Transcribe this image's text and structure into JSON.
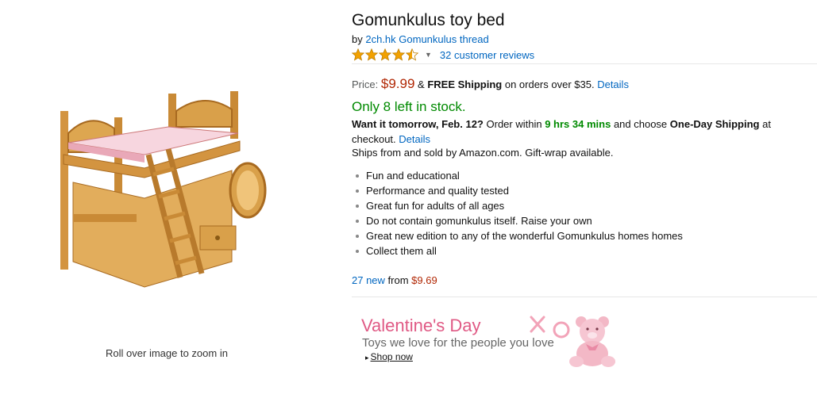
{
  "product": {
    "title": "Gomunkulus toy bed",
    "by_prefix": "by",
    "brand_link": "2ch.hk Gomunkulus thread",
    "rating_stars": 4.5,
    "reviews_link": "32 customer reviews",
    "zoom_hint": "Roll over image to zoom in"
  },
  "price": {
    "label": "Price:",
    "value": "$9.99",
    "free_shipping_prefix": "&",
    "free_shipping_bold": "FREE Shipping",
    "free_shipping_suffix": "on orders over $35.",
    "details_link": "Details"
  },
  "availability": {
    "stock": "Only 8 left in stock.",
    "want_it": "Want it tomorrow, Feb. 12?",
    "order_within": "Order within",
    "time_left": "9 hrs 34 mins",
    "and_choose": "and choose",
    "one_day": "One-Day Shipping",
    "at_checkout": "at checkout.",
    "details_link": "Details",
    "ships_from": "Ships from and sold by Amazon.com. Gift-wrap available."
  },
  "features": [
    "Fun and educational",
    "Performance and quality tested",
    "Great fun for adults of all ages",
    "Do not contain gomunkulus itself. Raise your own",
    "Great new edition to any of the wonderful Gomunkulus homes homes",
    "Collect them all"
  ],
  "offers": {
    "new_count_link": "27 new",
    "from": "from",
    "price": "$9.69"
  },
  "promo": {
    "title": "Valentine's Day",
    "subtitle": "Toys we love for the people you love",
    "link": "Shop now"
  },
  "colors": {
    "link": "#0066c0",
    "price": "#b12704",
    "stock_green": "#008a00",
    "star": "#f2a100",
    "promo_pink": "#e05a85"
  }
}
